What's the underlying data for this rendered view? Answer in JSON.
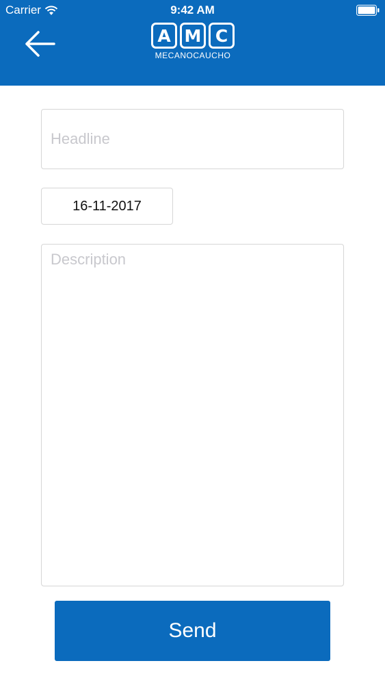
{
  "status_bar": {
    "carrier": "Carrier",
    "time": "9:42 AM"
  },
  "header": {
    "logo_letters": [
      "A",
      "M",
      "C"
    ],
    "logo_subtitle": "MECANOCAUCHO",
    "back_icon": "arrow-left-icon"
  },
  "form": {
    "headline": {
      "placeholder": "Headline",
      "value": ""
    },
    "date": {
      "value": "16-11-2017"
    },
    "description": {
      "placeholder": "Description",
      "value": ""
    },
    "send_label": "Send"
  },
  "colors": {
    "brand_blue": "#0b6bbd",
    "placeholder": "#c8c8cd",
    "border": "#d6d6d6"
  }
}
